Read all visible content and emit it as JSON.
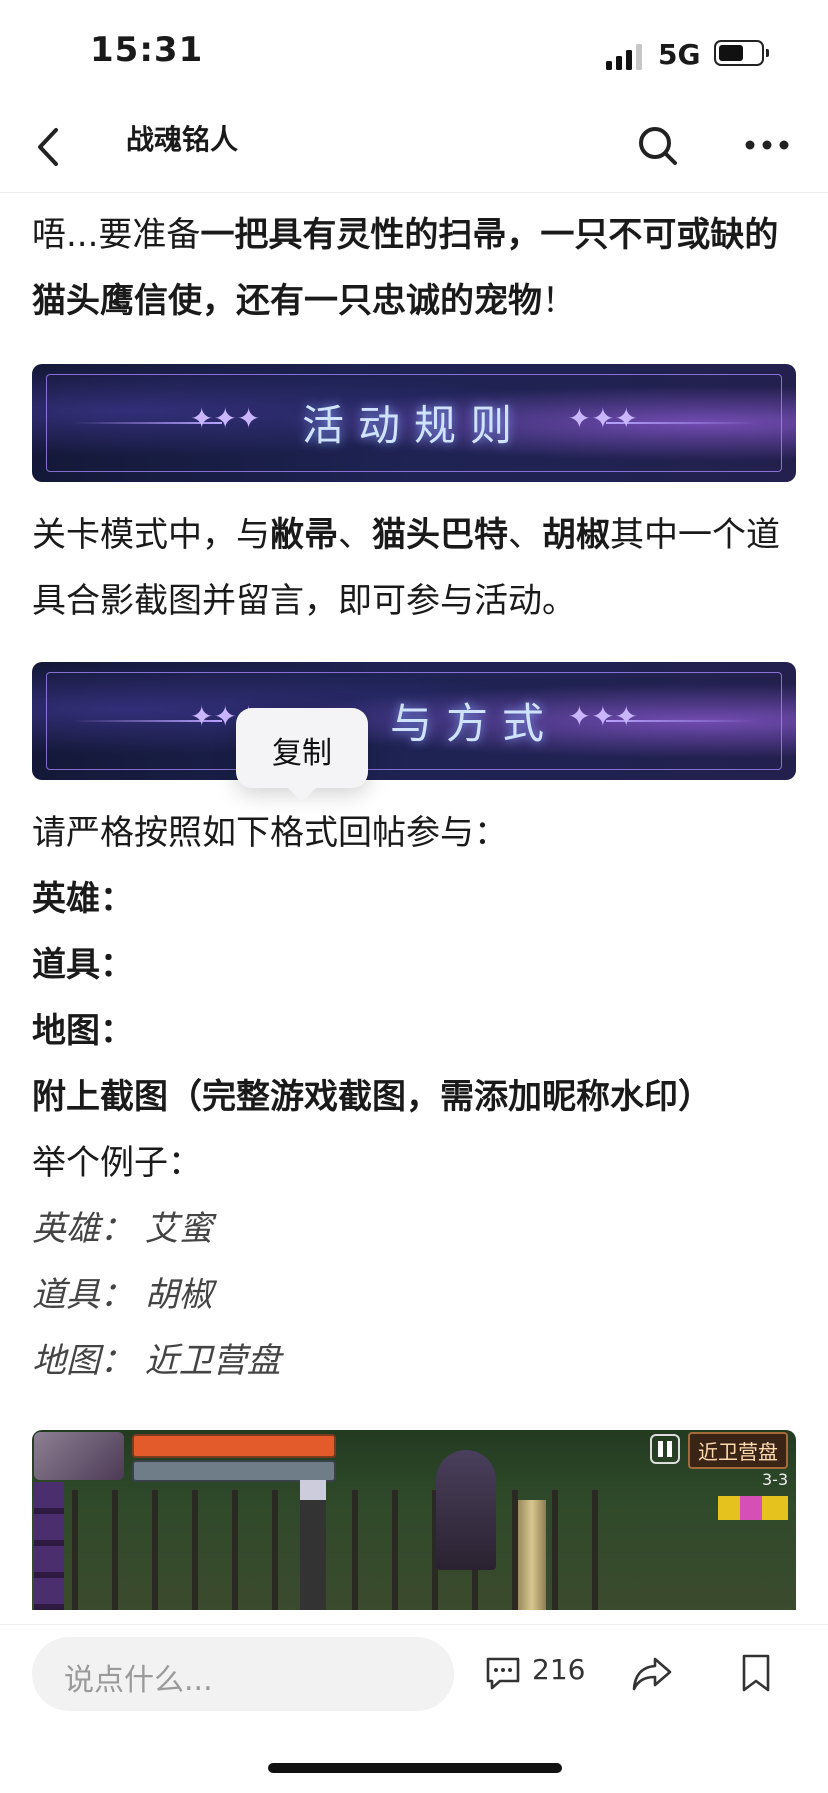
{
  "status_bar": {
    "time": "15:31",
    "network": "5G"
  },
  "nav": {
    "title": "战魂铭人"
  },
  "article": {
    "intro": [
      {
        "text": "唔...要准备",
        "bold": false
      },
      {
        "text": "一把具有灵性的扫帚，一只不可或缺的猫头鹰信使，还有一只忠诚的宠物",
        "bold": true
      },
      {
        "text": "！",
        "bold": false
      }
    ],
    "banner1": "活动规则",
    "rules": [
      {
        "text": "关卡模式中，与",
        "bold": false
      },
      {
        "text": "敝帚",
        "bold": true
      },
      {
        "text": "、",
        "bold": false
      },
      {
        "text": "猫头巴特",
        "bold": true
      },
      {
        "text": "、",
        "bold": false
      },
      {
        "text": "胡椒",
        "bold": true
      },
      {
        "text": "其中一个道具合影截图并留言，即可参与活动。",
        "bold": false
      }
    ],
    "banner2": "与方式",
    "format_intro": "请严格按照如下格式回帖参与：",
    "format_hero": "英雄：",
    "format_item": "道具：",
    "format_map": "地图：",
    "format_attach": "附上截图（完整游戏截图，需添加昵称水印）",
    "example_intro": "举个例子：",
    "example_hero": "英雄：  艾蜜",
    "example_item": "道具：  胡椒",
    "example_map": "地图：  近卫营盘",
    "screenshot": {
      "map_label": "近卫营盘",
      "stage": "3-3"
    }
  },
  "bottom_bar": {
    "comment_placeholder": "说点什么...",
    "comment_count": "216"
  },
  "popup": {
    "copy_label": "复制"
  },
  "icons": {
    "back": "chevron-left-icon",
    "search": "search-icon",
    "more": "more-dots-icon",
    "comment": "comment-icon",
    "share": "share-icon",
    "bookmark": "bookmark-icon"
  }
}
